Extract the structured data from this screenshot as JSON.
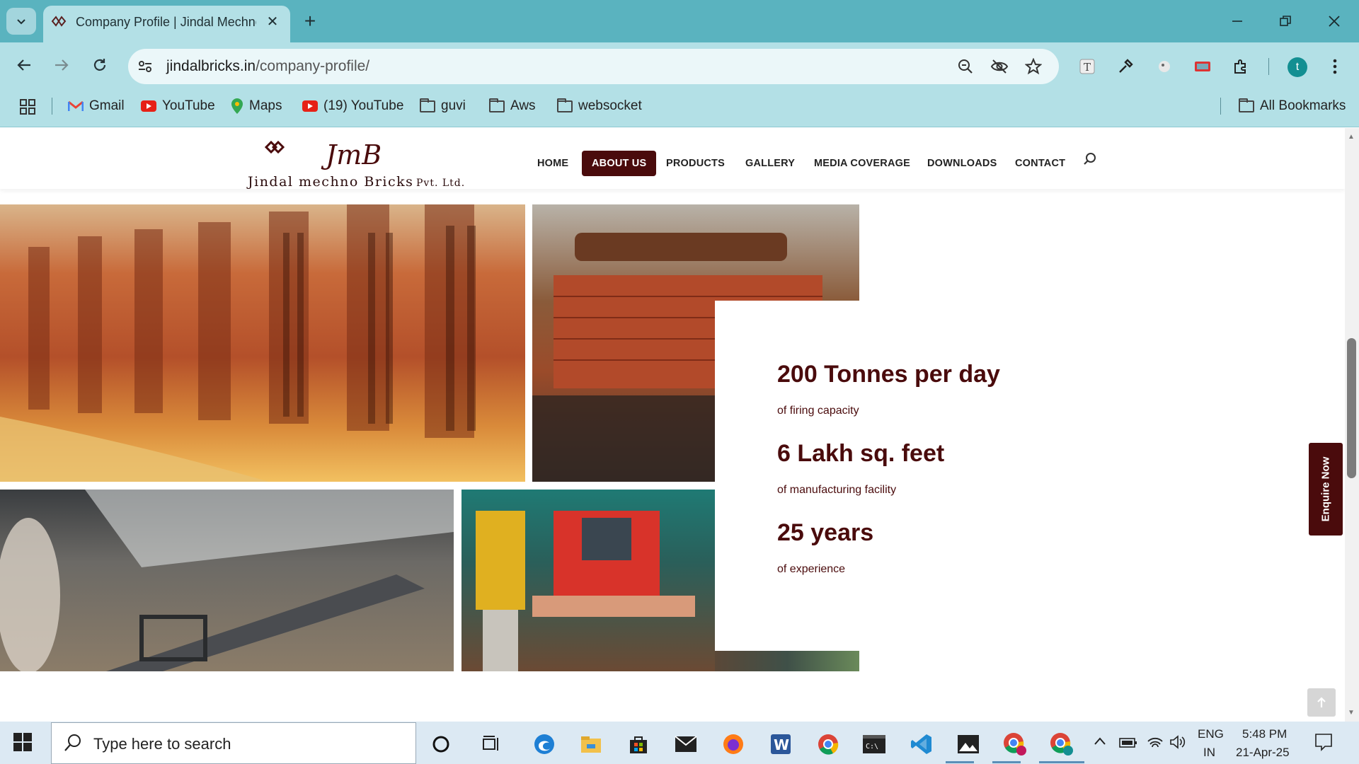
{
  "browser": {
    "tab_title": "Company Profile | Jindal Mechno Bricks",
    "url_domain": "jindalbricks.in",
    "url_path": "/company-profile/",
    "profile_initial": "t"
  },
  "bookmarks": [
    {
      "label": "Gmail",
      "icon": "gmail-icon"
    },
    {
      "label": "YouTube",
      "icon": "youtube-icon"
    },
    {
      "label": "Maps",
      "icon": "maps-icon"
    },
    {
      "label": "(19) YouTube",
      "icon": "youtube-icon"
    },
    {
      "label": "guvi",
      "icon": "folder-icon"
    },
    {
      "label": "Aws",
      "icon": "folder-icon"
    },
    {
      "label": "websocket",
      "icon": "folder-icon"
    }
  ],
  "all_bookmarks": "All Bookmarks",
  "site": {
    "logo_mark": "JmB",
    "logo_line1": "Jindal mechno Bricks",
    "logo_line2": "Pvt. Ltd.",
    "menu": [
      "HOME",
      "ABOUT US",
      "PRODUCTS",
      "GALLERY",
      "MEDIA COVERAGE",
      "DOWNLOADS",
      "CONTACT"
    ],
    "active_menu": "ABOUT US",
    "accent_color": "#4a0b0c"
  },
  "stats": [
    {
      "value": "200 Tonnes per day",
      "label": "of firing capacity"
    },
    {
      "value": "6 Lakh sq. feet",
      "label": "of manufacturing facility"
    },
    {
      "value": "25 years",
      "label": "of experience"
    }
  ],
  "enquire_label": "Enquire Now",
  "taskbar": {
    "search_placeholder": "Type here to search",
    "lang_top": "ENG",
    "lang_bottom": "IN",
    "time": "5:48 PM",
    "date": "21-Apr-25"
  }
}
